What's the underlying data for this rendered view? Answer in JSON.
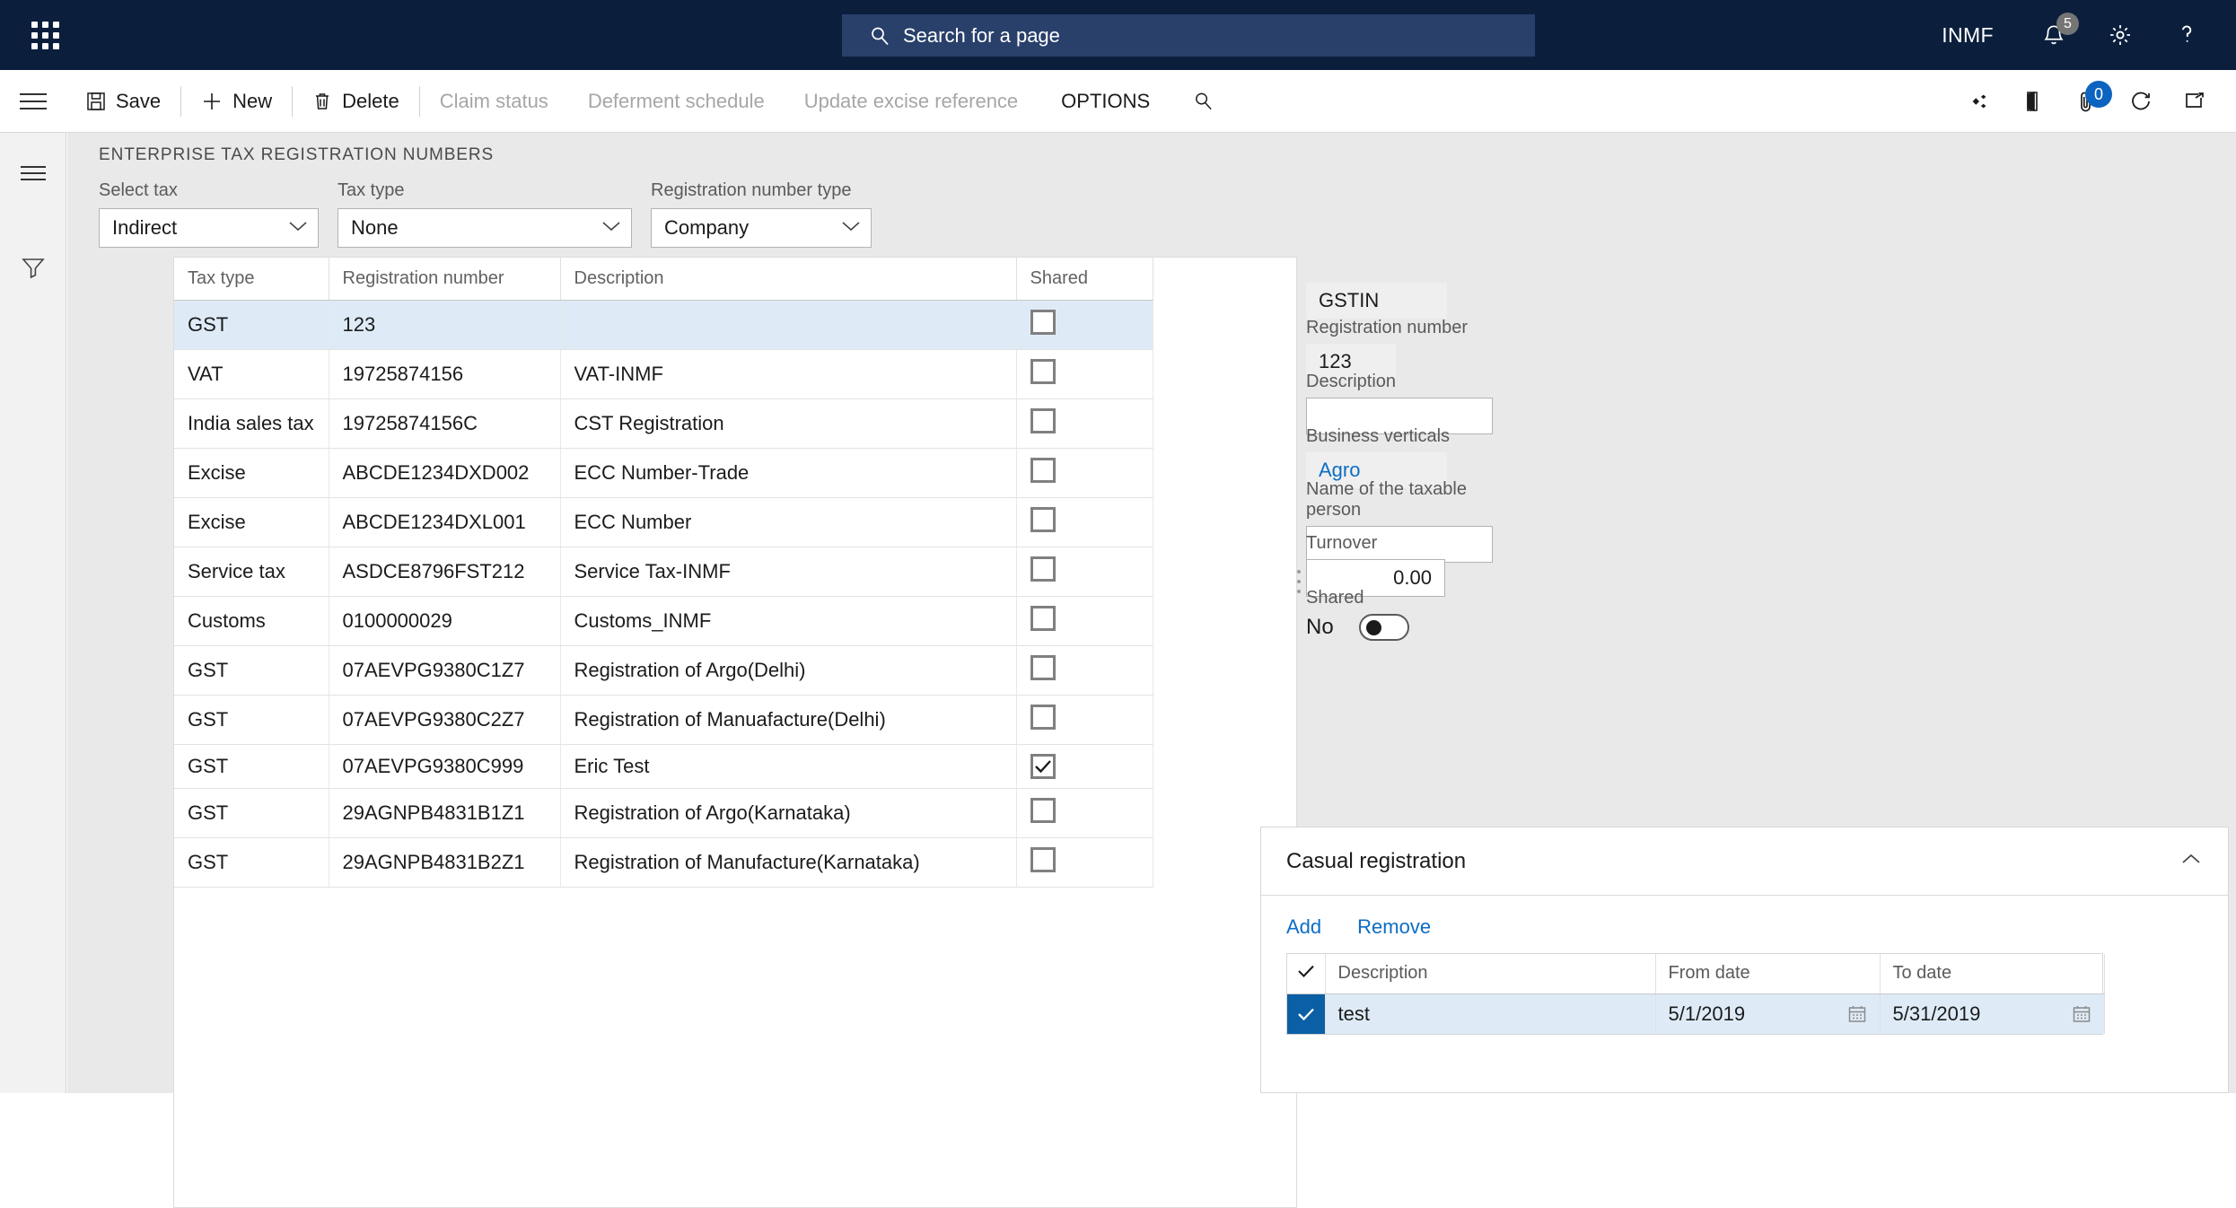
{
  "topbar": {
    "waffle_label": "waffle",
    "search_placeholder": "Search for a page",
    "company": "INMF",
    "notification_count": "5"
  },
  "actionpane": {
    "save": "Save",
    "new": "New",
    "delete": "Delete",
    "claim_status": "Claim status",
    "deferment_schedule": "Deferment schedule",
    "update_excise_reference": "Update excise reference",
    "options": "OPTIONS",
    "attachment_count": "0"
  },
  "page": {
    "title": "ENTERPRISE TAX REGISTRATION NUMBERS"
  },
  "filters": [
    {
      "label": "Select tax",
      "value": "Indirect"
    },
    {
      "label": "Tax type",
      "value": "None"
    },
    {
      "label": "Registration number type",
      "value": "Company"
    }
  ],
  "grid": {
    "columns": [
      "Tax type",
      "Registration number",
      "Description",
      "Shared"
    ],
    "rows": [
      {
        "type": "GST",
        "number": "123",
        "desc": "",
        "shared": false,
        "selected": true
      },
      {
        "type": "VAT",
        "number": "19725874156",
        "desc": "VAT-INMF",
        "shared": false,
        "selected": false
      },
      {
        "type": "India sales tax",
        "number": "19725874156C",
        "desc": "CST Registration",
        "shared": false,
        "selected": false
      },
      {
        "type": "Excise",
        "number": "ABCDE1234DXD002",
        "desc": "ECC Number-Trade",
        "shared": false,
        "selected": false
      },
      {
        "type": "Excise",
        "number": "ABCDE1234DXL001",
        "desc": "ECC Number",
        "shared": false,
        "selected": false
      },
      {
        "type": "Service tax",
        "number": "ASDCE8796FST212",
        "desc": "Service Tax-INMF",
        "shared": false,
        "selected": false
      },
      {
        "type": "Customs",
        "number": "0100000029",
        "desc": "Customs_INMF",
        "shared": false,
        "selected": false
      },
      {
        "type": "GST",
        "number": "07AEVPG9380C1Z7",
        "desc": "Registration of Argo(Delhi)",
        "shared": false,
        "selected": false
      },
      {
        "type": "GST",
        "number": "07AEVPG9380C2Z7",
        "desc": "Registration of Manuafacture(Delhi)",
        "shared": false,
        "selected": false
      },
      {
        "type": "GST",
        "number": "07AEVPG9380C999",
        "desc": "Eric Test",
        "shared": true,
        "selected": false
      },
      {
        "type": "GST",
        "number": "29AGNPB4831B1Z1",
        "desc": "Registration of Argo(Karnataka)",
        "shared": false,
        "selected": false
      },
      {
        "type": "GST",
        "number": "29AGNPB4831B2Z1",
        "desc": "Registration of Manufacture(Karnataka)",
        "shared": false,
        "selected": false
      }
    ]
  },
  "detail": {
    "header_value": "GSTIN",
    "registration_number_label": "Registration number",
    "registration_number_value": "123",
    "description_label": "Description",
    "description_value": "",
    "business_verticals_label": "Business verticals",
    "business_verticals_value": "Agro",
    "taxable_person_label": "Name of the taxable person",
    "taxable_person_value": "",
    "turnover_label": "Turnover",
    "turnover_value": "0.00",
    "shared_label": "Shared",
    "shared_value": "No"
  },
  "casual": {
    "title": "Casual registration",
    "add": "Add",
    "remove": "Remove",
    "columns": [
      "Description",
      "From date",
      "To date"
    ],
    "rows": [
      {
        "checked": true,
        "desc": "test",
        "from": "5/1/2019",
        "to": "5/31/2019",
        "selected": true
      }
    ]
  },
  "colors": {
    "nav_bg": "#0b1f3d",
    "search_bg": "#29406b",
    "accent_blue": "#0d6dc4",
    "row_selected": "#deebf7",
    "selected_chk": "#0b5fa5",
    "page_bg": "#e9e9e9"
  }
}
